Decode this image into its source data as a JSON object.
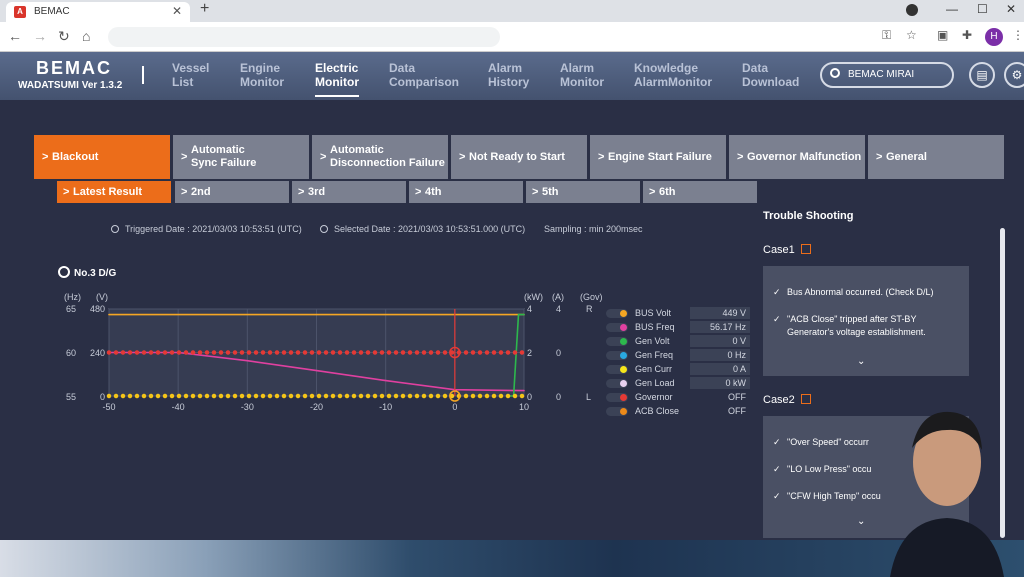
{
  "browser": {
    "tab_title": "BEMAC",
    "new_tab": "+",
    "avatar_letter": "H"
  },
  "header": {
    "logo": "BEMAC",
    "subtitle": "WADATSUMI  Ver 1.3.2",
    "nav": [
      {
        "l1": "Vessel",
        "l2": "List"
      },
      {
        "l1": "Engine",
        "l2": "Monitor"
      },
      {
        "l1": "Electric",
        "l2": "Monitor"
      },
      {
        "l1": "Data",
        "l2": "Comparison"
      },
      {
        "l1": "Alarm",
        "l2": "History"
      },
      {
        "l1": "Alarm",
        "l2": "Monitor"
      },
      {
        "l1": "Knowledge",
        "l2": "AlarmMonitor"
      },
      {
        "l1": "Data",
        "l2": "Download"
      }
    ],
    "search_value": "BEMAC MIRAI"
  },
  "categories": [
    {
      "l1": "Blackout",
      "l2": ""
    },
    {
      "l1": "Automatic",
      "l2": "Sync Failure"
    },
    {
      "l1": "Automatic",
      "l2": "Disconnection Failure"
    },
    {
      "l1": "Not Ready to Start",
      "l2": ""
    },
    {
      "l1": "Engine Start Failure",
      "l2": ""
    },
    {
      "l1": "Governor Malfunction",
      "l2": ""
    },
    {
      "l1": "General",
      "l2": ""
    }
  ],
  "subtabs": [
    "Latest Result",
    "2nd",
    "3rd",
    "4th",
    "5th",
    "6th"
  ],
  "meta": {
    "triggered": "Triggered Date : 2021/03/03 10:53:51 (UTC)",
    "selected": "Selected Date : 2021/03/03 10:53:51.000 (UTC)",
    "sampling": "Sampling : min 200msec"
  },
  "unit_label": "No.3 D/G",
  "axes": {
    "left_units": [
      "(Hz)",
      "(V)"
    ],
    "right_units": [
      "(kW)",
      "(A)",
      "(Gov)"
    ],
    "hz_ticks": [
      "65",
      "60",
      "55"
    ],
    "v_ticks": [
      "480",
      "240",
      "0"
    ],
    "kw_ticks": [
      "4",
      "2",
      "0"
    ],
    "a_ticks": [
      "4",
      "0",
      "0"
    ],
    "gov_ticks": [
      "R",
      "",
      "L"
    ],
    "x_ticks": [
      "-50",
      "-40",
      "-30",
      "-20",
      "-10",
      "0",
      "10"
    ]
  },
  "chart_data": {
    "type": "line",
    "x": [
      -50,
      -40,
      -30,
      -20,
      -10,
      0,
      10
    ],
    "xlim": [
      -50,
      10
    ],
    "ylim": [
      0,
      480
    ],
    "series": [
      {
        "name": "BUS Volt",
        "color": "#f5a623",
        "values": [
          449,
          449,
          449,
          449,
          449,
          449,
          449
        ]
      },
      {
        "name": "BUS Freq",
        "color": "#e040a0",
        "values": [
          240,
          240,
          195,
          140,
          85,
          35,
          30
        ]
      },
      {
        "name": "Gen Volt",
        "color": "#2db84d",
        "values": [
          0,
          0,
          0,
          0,
          0,
          0,
          449
        ]
      },
      {
        "name": "Governor",
        "color": "#e53935",
        "values": [
          240,
          240,
          240,
          240,
          240,
          240,
          240
        ]
      },
      {
        "name": "Gen Curr",
        "color": "#f5c518",
        "values": [
          0,
          0,
          0,
          0,
          0,
          0,
          0
        ]
      }
    ],
    "cursor_x": 0
  },
  "legend": [
    {
      "name": "BUS Volt",
      "value": "449 V",
      "color": "#f5a623"
    },
    {
      "name": "BUS Freq",
      "value": "56.17 Hz",
      "color": "#e040a0"
    },
    {
      "name": "Gen Volt",
      "value": "0 V",
      "color": "#2db84d"
    },
    {
      "name": "Gen Freq",
      "value": "0 Hz",
      "color": "#29a8e0"
    },
    {
      "name": "Gen Curr",
      "value": "0 A",
      "color": "#f5e51a"
    },
    {
      "name": "Gen Load",
      "value": "0 kW",
      "color": "#e8d0f0"
    },
    {
      "name": "Governor",
      "value": "OFF",
      "color": "#e53935"
    },
    {
      "name": "ACB Close",
      "value": "OFF",
      "color": "#ec8a1a"
    }
  ],
  "troubleshooting": {
    "title": "Trouble Shooting",
    "case1": {
      "label": "Case1",
      "items": [
        "Bus Abnormal occurred. (Check D/L)",
        "\"ACB Close\" tripped after ST-BY Generator's voltage establishment."
      ]
    },
    "case2": {
      "label": "Case2",
      "items": [
        "\"Over Speed\" occurr",
        "\"LO Low Press\" occu",
        "\"CFW High Temp\" occu"
      ]
    }
  }
}
